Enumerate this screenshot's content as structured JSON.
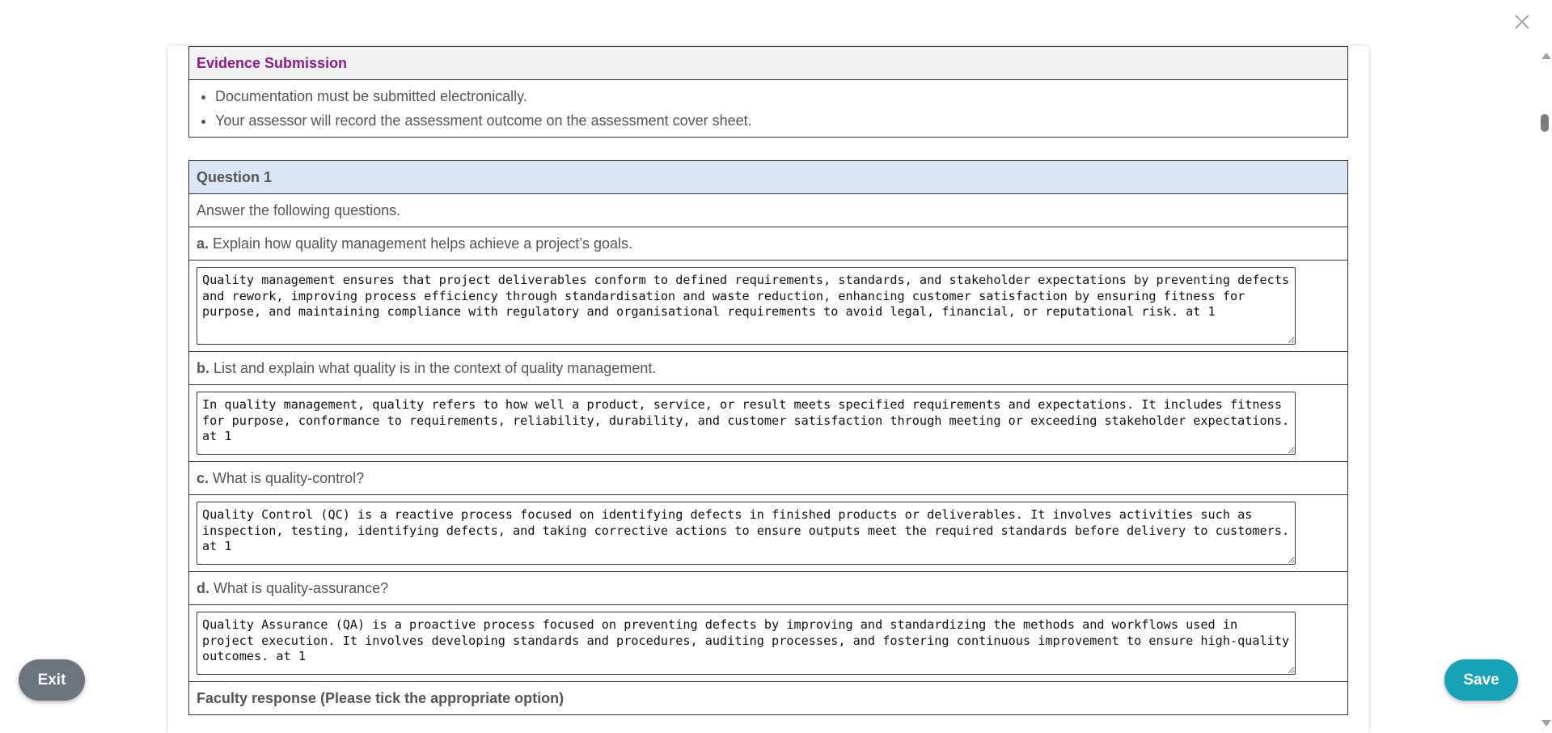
{
  "evidence": {
    "title": "Evidence Submission",
    "bullets": [
      "Documentation must be submitted electronically.",
      "Your assessor will record the assessment outcome on the assessment cover sheet."
    ]
  },
  "question": {
    "title": "Question 1",
    "instruction": "Answer the following questions.",
    "items": [
      {
        "letter": "a.",
        "text": "Explain how quality management helps achieve a project’s goals.",
        "answer": "Quality management ensures that project deliverables conform to defined requirements, standards, and stakeholder expectations by preventing defects and rework, improving process efficiency through standardisation and waste reduction, enhancing customer satisfaction by ensuring fitness for purpose, and maintaining compliance with regulatory and organisational requirements to avoid legal, financial, or reputational risk. at 1"
      },
      {
        "letter": "b.",
        "text": "List and explain what quality is in the context of quality management.",
        "answer": "In quality management, quality refers to how well a product, service, or result meets specified requirements and expectations. It includes fitness for purpose, conformance to requirements, reliability, durability, and customer satisfaction through meeting or exceeding stakeholder expectations. at 1"
      },
      {
        "letter": "c.",
        "text": "What is quality-control?",
        "answer": "Quality Control (QC) is a reactive process focused on identifying defects in finished products or deliverables. It involves activities such as inspection, testing, identifying defects, and taking corrective actions to ensure outputs meet the required standards before delivery to customers. at 1"
      },
      {
        "letter": "d.",
        "text": "What is quality-assurance?",
        "answer": "Quality Assurance (QA) is a proactive process focused on preventing defects by improving and standardizing the methods and workflows used in project execution. It involves developing standards and procedures, auditing processes, and fostering continuous improvement to ensure high-quality outcomes. at 1"
      }
    ],
    "faculty_title": "Faculty response (Please tick the appropriate option)"
  },
  "buttons": {
    "exit": "Exit",
    "save": "Save"
  },
  "colors": {
    "evidence_title": "#8e1a8e",
    "question_header_bg": "#dae6f5",
    "exit_bg": "#6c757d",
    "save_bg": "#17a2b8"
  },
  "icons": {
    "close": "close-icon",
    "scroll_up": "scroll-up-arrow",
    "scroll_down": "scroll-down-arrow"
  }
}
